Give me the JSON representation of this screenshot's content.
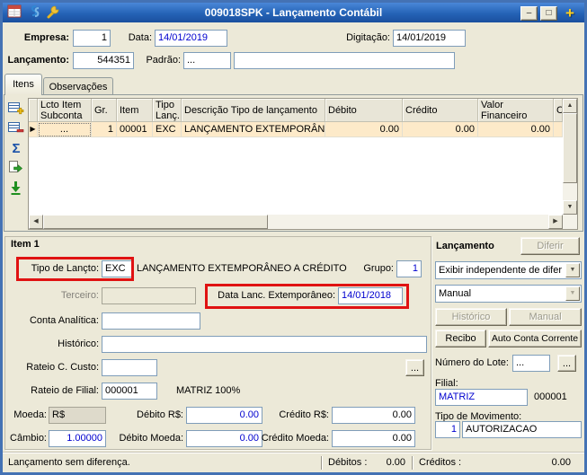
{
  "colors": {
    "titlebar_blue": "#2563b6",
    "window_border_blue": "#4472b4",
    "window_bg": "#ece9d8",
    "annotation_red": "#e01212",
    "field_text_blue": "#0000cf",
    "row_highlight": "#fdeac9",
    "plus_gold": "#ffd01e"
  },
  "icons": {
    "sum": "Σ",
    "row_pointer": "▶",
    "up": "▲",
    "down": "▼",
    "left": "◀",
    "right": "▶",
    "dropdown": "▼"
  },
  "titlebar": {
    "title": "009018SPK - Lançamento Contábil",
    "minimize": "–",
    "maximize": "□",
    "plus": "+"
  },
  "form": {
    "empresa_label": "Empresa:",
    "empresa_value": "1",
    "data_label": "Data:",
    "data_value": "14/01/2019",
    "digitacao_label": "Digitação:",
    "digitacao_value": "14/01/2019",
    "lancamento_label": "Lançamento:",
    "lancamento_value": "544351",
    "padrao_label": "Padrão:",
    "padrao_value": "..."
  },
  "tabs": {
    "itens": "Itens",
    "observacoes": "Observações"
  },
  "grid": {
    "columns": [
      "Lcto Item Subconta",
      "Gr.",
      "Item",
      "Tipo Lanç.",
      "Descrição Tipo de lançamento",
      "Débito",
      "Crédito",
      "Valor Financeiro",
      "Co"
    ],
    "row": {
      "lcto_item_subconta": "...",
      "gr": "1",
      "item": "00001",
      "tipo_lanc": "EXC",
      "descricao": "LANÇAMENTO EXTEMPORÂNE",
      "debito": "0.00",
      "credito": "0.00",
      "valor_financeiro": "0.00"
    }
  },
  "item_panel": {
    "title": "Item 1",
    "tipo_lancto_label": "Tipo de Lançto:",
    "tipo_lancto_value": "EXC",
    "tipo_lancto_desc": "LANÇAMENTO EXTEMPORÂNEO A CRÉDITO",
    "grupo_label": "Grupo:",
    "grupo_value": "1",
    "terceiro_label": "Terceiro:",
    "data_ext_label": "Data Lanc. Extemporâneo:",
    "data_ext_value": "14/01/2018",
    "conta_analitica_label": "Conta Analítica:",
    "historico_label": "Histórico:",
    "rateio_custo_label": "Rateio C. Custo:",
    "rateio_custo_browse": "...",
    "rateio_filial_label": "Rateio de Filial:",
    "rateio_filial_value": "000001",
    "rateio_filial_desc": "MATRIZ 100%",
    "moeda_label": "Moeda:",
    "moeda_value": "R$",
    "debito_rs_label": "Débito R$:",
    "debito_rs_value": "0.00",
    "credito_rs_label": "Crédito R$:",
    "credito_rs_value": "0.00",
    "cambio_label": "Câmbio:",
    "cambio_value": "1.00000",
    "debito_moeda_label": "Débito Moeda:",
    "debito_moeda_value": "0.00",
    "credito_moeda_label": "Crédito Moeda:",
    "credito_moeda_value": "0.00"
  },
  "lancamento_panel": {
    "title": "Lançamento",
    "diferir_button": "Diferir",
    "exibir_combo": "Exibir independente de difer",
    "modo_combo": "Manual",
    "historico_button": "Histórico",
    "manual_button": "Manual",
    "recibo_button": "Recibo",
    "auto_conta_button": "Auto Conta Corrente",
    "lote_label": "Número do Lote:",
    "lote_value": "...",
    "lote_browse": "...",
    "filial_label": "Filial:",
    "filial_value": "MATRIZ",
    "filial_code": "000001",
    "tipo_mov_label": "Tipo de Movimento:",
    "tipo_mov_value": "1",
    "tipo_mov_desc": "AUTORIZACAO"
  },
  "statusbar": {
    "message": "Lançamento sem diferença.",
    "debitos_label": "Débitos :",
    "debitos_value": "0.00",
    "creditos_label": "Créditos :",
    "creditos_value": "0.00"
  }
}
